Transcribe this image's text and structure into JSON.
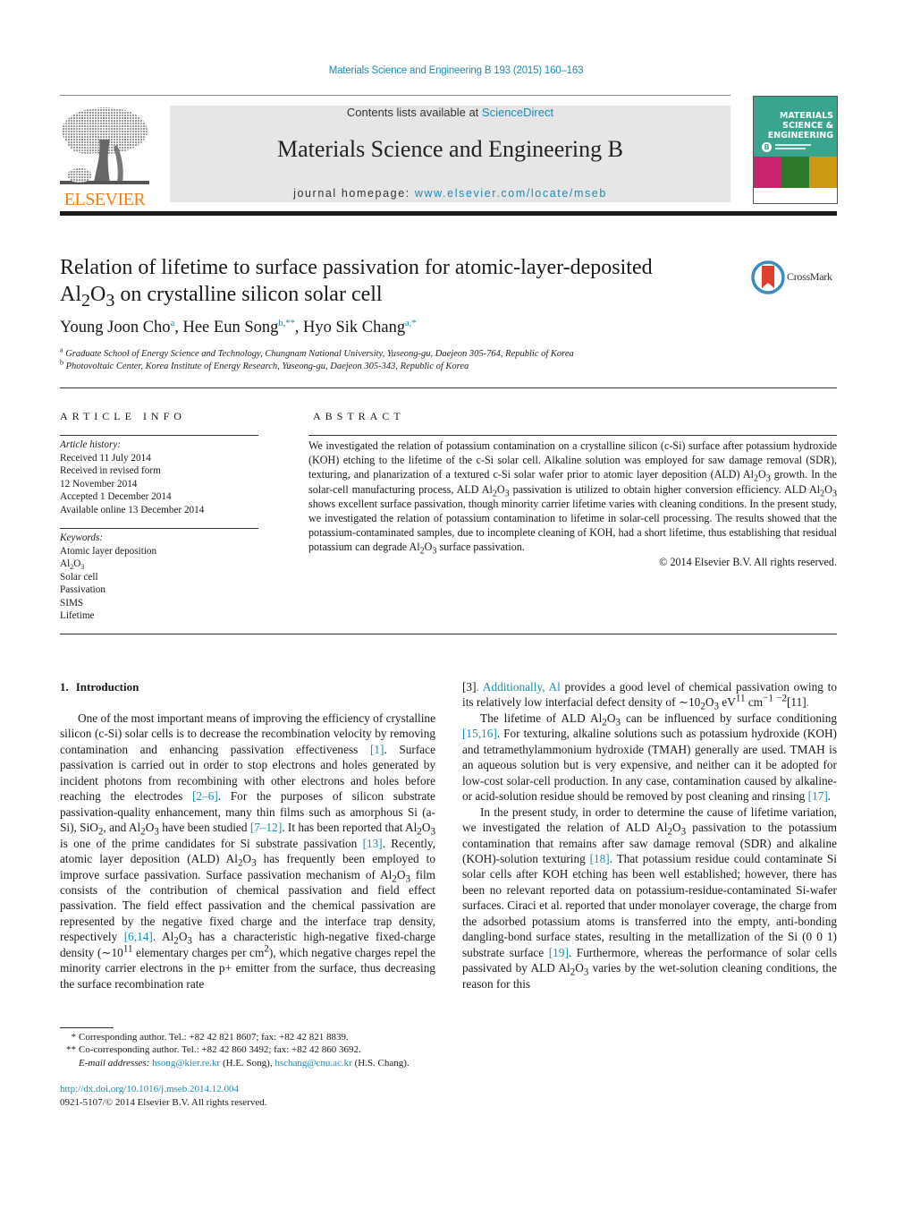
{
  "header": {
    "citation": "Materials Science and Engineering B 193 (2015) 160–163",
    "contents_prefix": "Contents lists available at ",
    "contents_link": "ScienceDirect",
    "journal_name": "Materials Science and Engineering B",
    "homepage_prefix": "journal homepage: ",
    "homepage_link": "www.elsevier.com/locate/mseb",
    "publisher_logo_text": "ELSEVIER",
    "cover": {
      "line1": "MATERIALS",
      "line2": "SCIENCE &",
      "line3": "ENGINEERING",
      "badge": "B"
    },
    "colors": {
      "link": "#1d8bb5",
      "elsevier_orange": "#f07f19",
      "masthead_bg": "#e6e6e6",
      "cover_green": "#3aa58e"
    }
  },
  "article": {
    "title_line1": "Relation of lifetime to surface passivation for atomic-layer-deposited",
    "title_line2_pre": "Al",
    "title_line2_sub1": "2",
    "title_line2_mid": "O",
    "title_line2_sub2": "3",
    "title_line2_post": " on crystalline silicon solar cell",
    "crossmark_label": "CrossMark",
    "authors": [
      {
        "name": "Young Joon Cho",
        "sup": "a"
      },
      {
        "name": "Hee Eun Song",
        "sup": "b,**"
      },
      {
        "name": "Hyo Sik Chang",
        "sup": "a,*"
      }
    ],
    "affiliations": [
      {
        "mark": "a",
        "text": "Graduate School of Energy Science and Technology, Chungnam National University, Yuseong-gu, Daejeon 305-764, Republic of Korea"
      },
      {
        "mark": "b",
        "text": "Photovoltaic Center, Korea Institute of Energy Research, Yuseong-gu, Daejeon 305-343, Republic of Korea"
      }
    ]
  },
  "article_info": {
    "heading": "ARTICLE INFO",
    "history_label": "Article history:",
    "history": [
      "Received 11 July 2014",
      "Received in revised form",
      "12 November 2014",
      "Accepted 1 December 2014",
      "Available online 13 December 2014"
    ],
    "keywords_label": "Keywords:",
    "keywords": [
      "Atomic layer deposition",
      "Al2O3",
      "Solar cell",
      "Passivation",
      "SIMS",
      "Lifetime"
    ]
  },
  "abstract": {
    "heading": "ABSTRACT",
    "text_1": "We investigated the relation of potassium contamination on a crystalline silicon (c-Si) surface after potassium hydroxide (KOH) etching to the lifetime of the c-Si solar cell. Alkaline solution was employed for saw damage removal (SDR), texturing, and planarization of a textured c-Si solar wafer prior to atomic layer deposition (ALD) Al",
    "text_2": " growth. In the solar-cell manufacturing process, ALD Al",
    "text_3": " passivation is utilized to obtain higher conversion efficiency. ALD Al",
    "text_4": " shows excellent surface passivation, though minority carrier lifetime varies with cleaning conditions. In the present study, we investigated the relation of potassium contamination to lifetime in solar-cell processing. The results showed that the potassium-contaminated samples, due to incomplete cleaning of KOH, had a short lifetime, thus establishing that residual potassium can degrade Al",
    "text_5": " surface passivation.",
    "copyright": "© 2014 Elsevier B.V. All rights reserved."
  },
  "body": {
    "section_number": "1.",
    "section_title": "Introduction",
    "p1": [
      "One of the most important means of improving the efficiency of crystalline silicon (c-Si) solar cells is to decrease the recombination velocity by removing contamination and enhancing passivation effectiveness ",
      "[1]",
      ". Surface passivation is carried out in order to stop electrons and holes generated by incident photons from recombining with other electrons and holes before reaching the electrodes ",
      "[2–6]",
      ". For the purposes of silicon substrate passivation-quality enhancement, many thin films such as amorphous Si (a-Si), SiO",
      ", and Al",
      " have been studied ",
      "[7–12]",
      ". It has been reported that Al",
      " is one of the prime candidates for Si substrate passivation ",
      "[13]",
      ". Recently, atomic layer deposition (ALD) Al",
      " has frequently been employed to improve surface passivation. Surface passivation mechanism of Al",
      " film consists of the contribution of chemical passivation and field effect passivation. The field effect passivation and the chemical passivation are represented by the negative fixed charge and the interface trap density, respectively ",
      "[6,14]",
      ". Al",
      " has a characteristic high-negative fixed-charge density (∼10",
      " elementary charges per cm",
      "), which negative charges repel the minority carrier electrons in the p+ emitter from the surface, thus decreasing the surface recombination rate ",
      "[3]",
      ". Additionally, Al",
      " provides a good level of chemical passivation owing to its relatively low interfacial defect density of ∼10",
      " eV",
      " cm",
      " ",
      "[11]",
      "."
    ],
    "p2": [
      "The lifetime of ALD Al",
      " can be influenced by surface conditioning ",
      "[15,16]",
      ". For texturing, alkaline solutions such as potassium hydroxide (KOH) and tetramethylammonium hydroxide (TMAH) generally are used. TMAH is an aqueous solution but is very expensive, and neither can it be adopted for low-cost solar-cell production. In any case, contamination caused by alkaline- or acid-solution residue should be removed by post cleaning and rinsing ",
      "[17]",
      "."
    ],
    "p3": [
      "In the present study, in order to determine the cause of lifetime variation, we investigated the relation of ALD Al",
      " passivation to the potassium contamination that remains after saw damage removal (SDR) and alkaline (KOH)-solution texturing ",
      "[18]",
      ". That potassium residue could contaminate Si solar cells after KOH etching has been well established; however, there has been no relevant reported data on potassium-residue-contaminated Si-wafer surfaces. Ciraci et al. reported that under monolayer coverage, the charge from the adsorbed potassium atoms is transferred into the empty, anti-bonding dangling-bond surface states, resulting in the metallization of the Si (0 0 1) substrate surface ",
      "[19]",
      ". Furthermore, whereas the performance of solar cells passivated by ALD Al",
      " varies by the wet-solution cleaning conditions, the reason for this"
    ],
    "sub": {
      "two": "2",
      "three": "3",
      "eleven": "11",
      "minus1": "−1",
      "minus2": "−2"
    },
    "o": "O"
  },
  "footnotes": {
    "fn1_mark": "*",
    "fn1": "Corresponding author. Tel.: +82 42 821 8607; fax: +82 42 821 8839.",
    "fn2_mark": "**",
    "fn2": "Co-corresponding author. Tel.: +82 42 860 3492; fax: +82 42 860 3692.",
    "email_label": "E-mail addresses: ",
    "email1": "hsong@kier.re.kr",
    "email1_name": " (H.E. Song), ",
    "email2": "hschang@cnu.ac.kr",
    "email2_name": " (H.S. Chang).",
    "doi": "http://dx.doi.org/10.1016/j.mseb.2014.12.004",
    "issn": "0921-5107/© 2014 Elsevier B.V. All rights reserved."
  }
}
